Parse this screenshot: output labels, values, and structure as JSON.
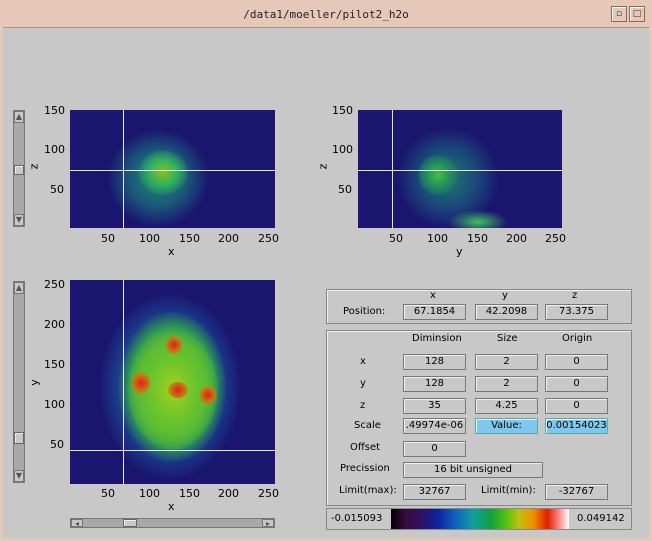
{
  "window": {
    "title": "/data1/moeller/pilot2_h2o",
    "minimize_icon": "minimize-icon",
    "maximize_icon": "maximize-icon"
  },
  "plots": {
    "xz": {
      "xlabel": "x",
      "ylabel": "z",
      "xticks": [
        "50",
        "100",
        "150",
        "200",
        "250"
      ],
      "yticks": [
        "150",
        "100",
        "50"
      ]
    },
    "yz": {
      "xlabel": "y",
      "ylabel": "z",
      "xticks": [
        "50",
        "100",
        "150",
        "200",
        "250"
      ],
      "yticks": [
        "150",
        "100",
        "50"
      ]
    },
    "xy": {
      "xlabel": "x",
      "ylabel": "y",
      "xticks": [
        "50",
        "100",
        "150",
        "200",
        "250"
      ],
      "yticks": [
        "250",
        "200",
        "150",
        "100",
        "50"
      ]
    }
  },
  "position": {
    "label": "Position:",
    "headers": [
      "x",
      "y",
      "z"
    ],
    "values": [
      "67.1854",
      "42.2098",
      "73.375"
    ]
  },
  "info": {
    "headers": {
      "dimension": "Diminsion",
      "size": "Size",
      "origin": "Origin"
    },
    "rows": [
      {
        "label": "x",
        "dimension": "128",
        "size": "2",
        "origin": "0"
      },
      {
        "label": "y",
        "dimension": "128",
        "size": "2",
        "origin": "0"
      },
      {
        "label": "z",
        "dimension": "35",
        "size": "4.25",
        "origin": "0"
      }
    ],
    "scale_label": "Scale",
    "scale_value": ".49974e-06",
    "value_label": "Value:",
    "value_value": "0.00154023",
    "offset_label": "Offset",
    "offset_value": "0",
    "precision_label": "Precission",
    "precision_value": "16 bit unsigned",
    "limit_max_label": "Limit(max):",
    "limit_max_value": "32767",
    "limit_min_label": "Limit(min):",
    "limit_min_value": "-32767"
  },
  "colorbar": {
    "min": "-0.015093",
    "max": "0.049142"
  },
  "colors": {
    "background": "#c8c8c8",
    "titlebar": "#e6c8b8",
    "plot_background": "#1a1670",
    "value_highlight": "#7ec8f0"
  }
}
